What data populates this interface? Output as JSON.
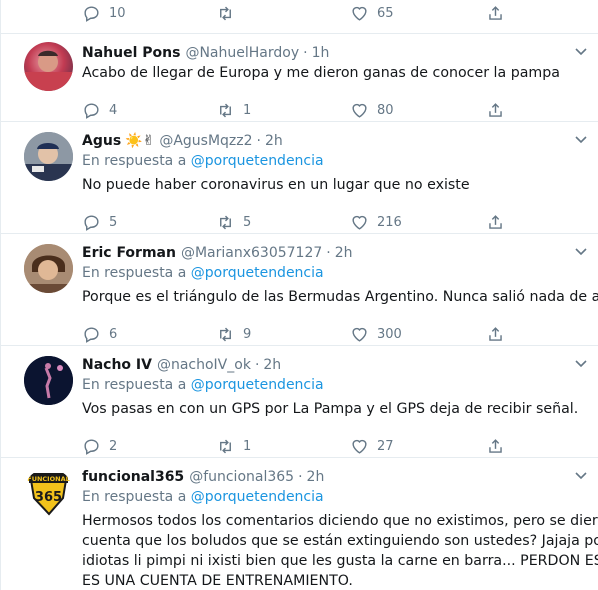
{
  "colors": {
    "accent": "#1b95e0",
    "muted": "#657786",
    "text": "#14171a",
    "border": "#e6ecf0"
  },
  "top_actions": {
    "reply": "10",
    "retweet": "",
    "like": "65"
  },
  "tweets": [
    {
      "name": "Nahuel Pons",
      "emoji": "",
      "handle": "@NahuelHardoy",
      "time": "1h",
      "reply_prefix": "",
      "reply_to": "",
      "lines": [
        "Acabo de llegar de Europa y me dieron ganas de conocer la pampa"
      ],
      "reply_count": "4",
      "retweet_count": "1",
      "like_count": "80"
    },
    {
      "name": "Agus",
      "emoji": "☀️✌",
      "handle": "@AgusMqzz2",
      "time": "2h",
      "reply_prefix": "En respuesta a ",
      "reply_to": "@porquetendencia",
      "lines": [
        "No puede haber coronavirus en un lugar que no existe"
      ],
      "reply_count": "5",
      "retweet_count": "5",
      "like_count": "216"
    },
    {
      "name": "Eric Forman",
      "emoji": "",
      "handle": "@Marianx63057127",
      "time": "2h",
      "reply_prefix": "En respuesta a ",
      "reply_to": "@porquetendencia",
      "lines": [
        "Porque es el triángulo de las Bermudas Argentino. Nunca salió nada de ahí"
      ],
      "reply_count": "6",
      "retweet_count": "9",
      "like_count": "300"
    },
    {
      "name": "Nacho IV",
      "emoji": "",
      "handle": "@nachoIV_ok",
      "time": "2h",
      "reply_prefix": "En respuesta a ",
      "reply_to": "@porquetendencia",
      "lines": [
        "Vos pasas en con un GPS por La Pampa y el GPS deja de recibir señal."
      ],
      "reply_count": "2",
      "retweet_count": "1",
      "like_count": "27"
    },
    {
      "name": "funcional365",
      "emoji": "",
      "handle": "@funcional365",
      "time": "2h",
      "reply_prefix": "En respuesta a ",
      "reply_to": "@porquetendencia",
      "lines": [
        "Hermosos todos los comentarios diciendo que no existimos, pero se dieron",
        "cuenta que los boludos que se están extinguiendo son ustedes? Jajaja pobre",
        "idiotas li pimpi ni ixisti bien que les gusta la carne en barra... PERDON ESTÁ",
        "ES UNA CUENTA DE ENTRENAMIENTO."
      ],
      "reply_count": "",
      "retweet_count": "",
      "like_count": "",
      "avatar_text": {
        "top": "FUNCIONAL",
        "num": "365"
      }
    }
  ]
}
